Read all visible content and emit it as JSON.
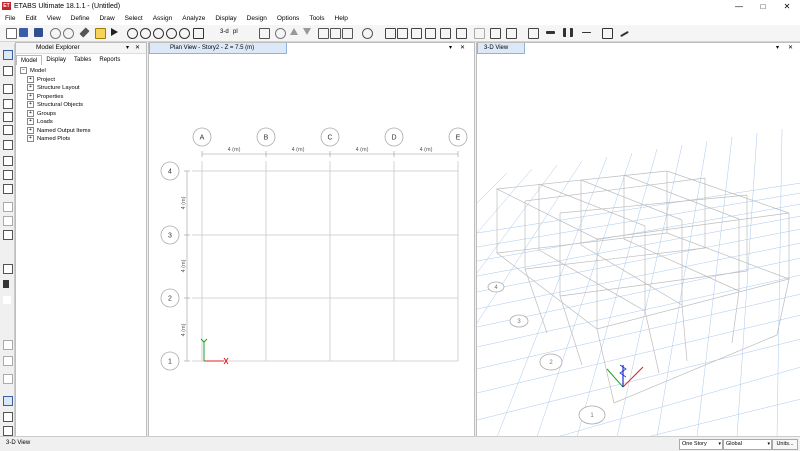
{
  "app": {
    "title": "ETABS Ultimate 18.1.1 - (Untitled)",
    "logo_text": "ET",
    "window_controls": {
      "minimize": "—",
      "maximize": "□",
      "close": "✕"
    }
  },
  "menu": [
    "File",
    "Edit",
    "View",
    "Define",
    "Draw",
    "Select",
    "Assign",
    "Analyze",
    "Display",
    "Design",
    "Options",
    "Tools",
    "Help"
  ],
  "toolbar": {
    "view_3d_label": "3-d",
    "plan_label": "pl",
    "elev_label": "el"
  },
  "explorer": {
    "title": "Model Explorer",
    "pin": "▾",
    "close": "✕",
    "tabs": [
      "Model",
      "Display",
      "Tables",
      "Reports"
    ],
    "active_tab": "Model",
    "root": "Model",
    "items": [
      "Project",
      "Structure Layout",
      "Properties",
      "Structural Objects",
      "Groups",
      "Loads",
      "Named Output Items",
      "Named Plots"
    ]
  },
  "plan_view": {
    "title": "Plan View - Story2 - Z = 7.5 (m)",
    "grid_x_labels": [
      "A",
      "B",
      "C",
      "D",
      "E"
    ],
    "grid_y_labels": [
      "4",
      "3",
      "2",
      "1"
    ],
    "x_spacings": [
      "4 (m)",
      "4 (m)",
      "4 (m)",
      "4 (m)"
    ],
    "y_spacings": [
      "4 (m)",
      "4 (m)",
      "4 (m)"
    ]
  },
  "view_3d": {
    "title": "3-D View",
    "grid_bubbles": [
      "4",
      "3",
      "2",
      "1"
    ]
  },
  "statusbar": {
    "text": "3-D View",
    "story": "One Story",
    "coord": "Global",
    "units": "Units..."
  },
  "colors": {
    "logo": "#c0262d",
    "active_tab_bg": "#dbe8f7",
    "grid_line": "#c8c8c8",
    "ground_grid": "#a9c9ec",
    "axis_x": "#e02020",
    "axis_y": "#1aa31a",
    "axis_z": "#2030d0"
  }
}
